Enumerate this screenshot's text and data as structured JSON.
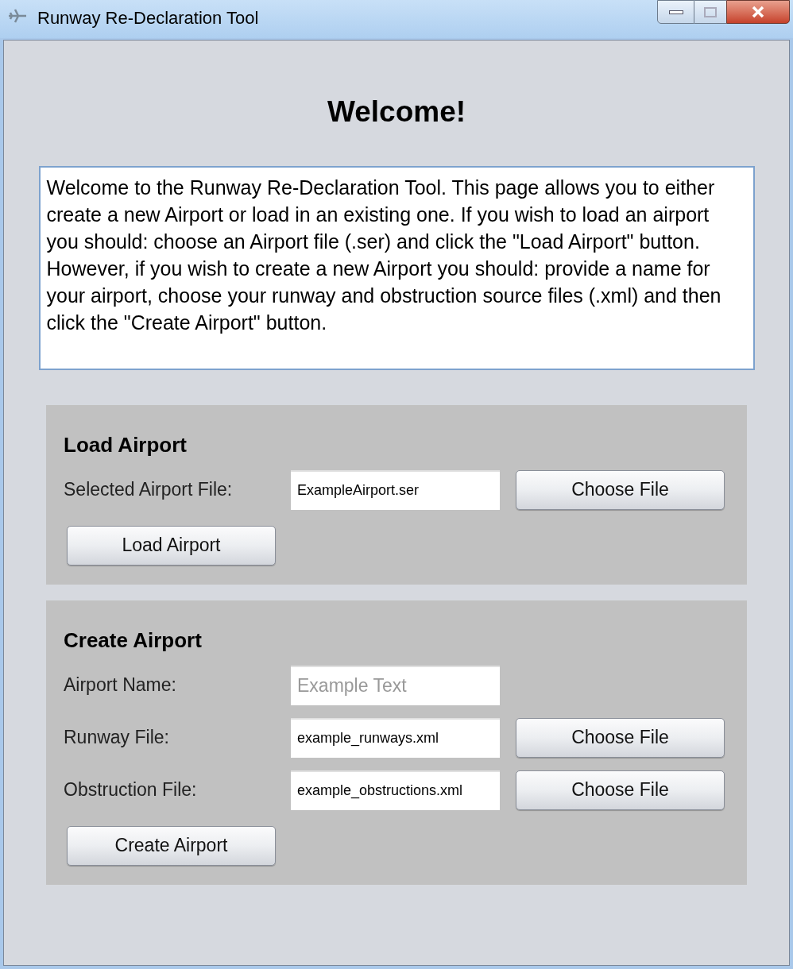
{
  "window": {
    "title": "Runway Re-Declaration Tool"
  },
  "heading": "Welcome!",
  "description": "Welcome to the Runway Re-Declaration Tool. This page allows you to either create a new Airport or load in an existing one. If you wish to load an airport you should: choose an Airport file (.ser) and click the \"Load Airport\" button. However, if you wish to create a new Airport you should: provide a name for your airport, choose your runway and obstruction source files (.xml) and then click the \"Create Airport\" button.",
  "sections": [
    {
      "title": "Load Airport",
      "fields": [
        {
          "kind": "file",
          "label": "Selected Airport File:",
          "value": "ExampleAirport.ser",
          "button": "Choose File"
        }
      ],
      "button": "Load Airport"
    },
    {
      "title": "Create Airport",
      "fields": [
        {
          "kind": "text",
          "label": "Airport Name:",
          "placeholder": "Example Text"
        },
        {
          "kind": "file",
          "label": "Runway File:",
          "value": "example_runways.xml",
          "button": "Choose File"
        },
        {
          "kind": "file",
          "label": "Obstruction File:",
          "value": "example_obstructions.xml",
          "button": "Choose File"
        }
      ],
      "button": "Create Airport"
    }
  ]
}
